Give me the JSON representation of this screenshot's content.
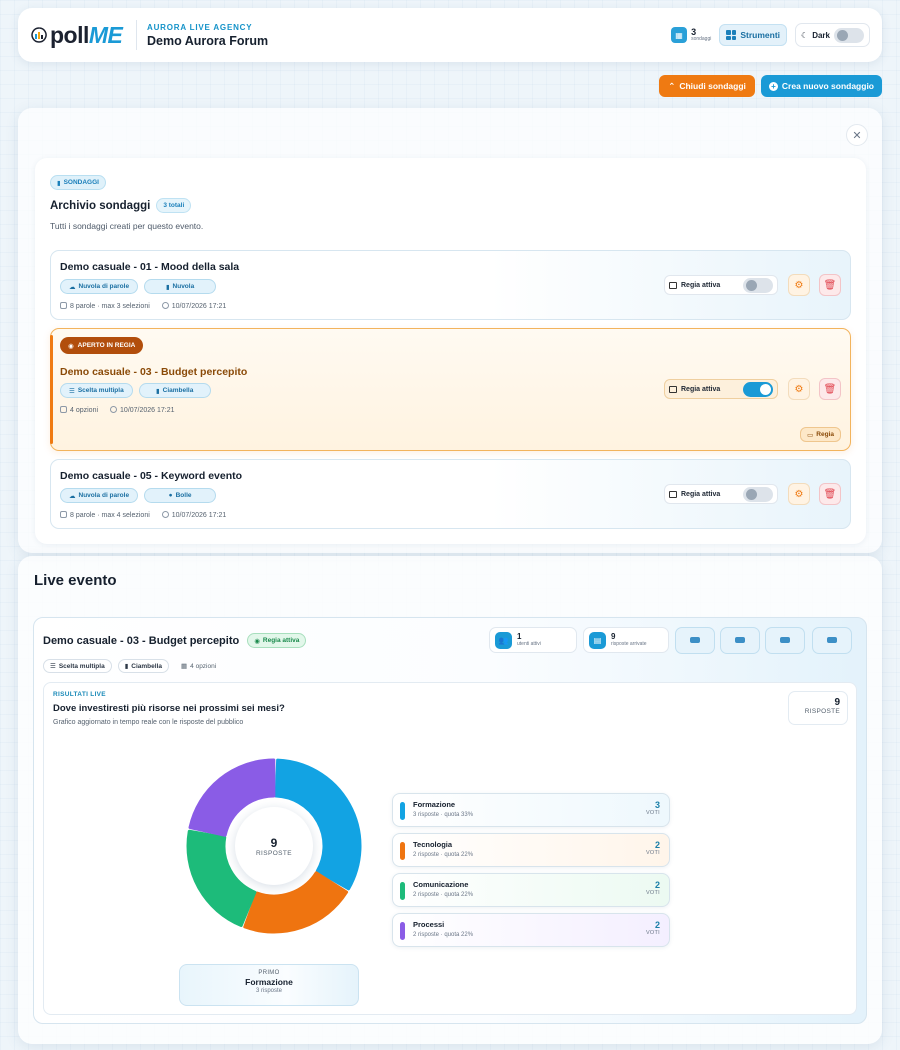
{
  "header": {
    "logo_left": "poll",
    "logo_right": "ME",
    "agency_label": "AURORA LIVE AGENCY",
    "event_title": "Demo Aurora Forum",
    "poll_count": "3",
    "poll_count_label": "sondaggi",
    "tools_label": "Strumenti",
    "dark_label": "Dark"
  },
  "actions": {
    "close_polls": "Chiudi sondaggi",
    "new_poll": "Crea nuovo sondaggio"
  },
  "archive": {
    "section_pill": "SONDAGGI",
    "title": "Archivio sondaggi",
    "total_pill": "3 totali",
    "subtitle": "Tutti i sondaggi creati per questo evento.",
    "regia_label": "Regia attiva",
    "polls": [
      {
        "title": "Demo casuale - 01 - Mood della sala",
        "tag1": "Nuvola di parole",
        "tag2": "Nuvola",
        "meta_info": "8 parole · max 3 selezioni",
        "meta_date": "10/07/2026 17:21",
        "regia_active": false
      },
      {
        "open_pill": "APERTO IN REGIA",
        "title": "Demo casuale - 03 - Budget percepito",
        "tag1": "Scelta multipla",
        "tag2": "Ciambella",
        "meta_info": "4 opzioni",
        "meta_date": "10/07/2026 17:21",
        "regia_active": true,
        "regia_small": "Regia"
      },
      {
        "title": "Demo casuale - 05 - Keyword evento",
        "tag1": "Nuvola di parole",
        "tag2": "Bolle",
        "meta_info": "8 parole · max 4 selezioni",
        "meta_date": "10/07/2026 17:21",
        "regia_active": false
      }
    ]
  },
  "live": {
    "title": "Live evento",
    "poll_title": "Demo casuale - 03 - Budget percepito",
    "regia_pill": "Regia attiva",
    "tag1": "Scelta multipla",
    "tag2": "Ciambella",
    "tag3": "4 opzioni",
    "users_num": "1",
    "users_label": "utenti attivi",
    "answers_num": "9",
    "answers_label": "risposte arrivate",
    "kicker": "RISULTATI LIVE",
    "question": "Dove investiresti più risorse nei prossimi sei mesi?",
    "question_sub": "Grafico aggiornato in tempo reale con le risposte del pubblico",
    "total_num": "9",
    "total_label": "RISPOSTE",
    "center_num": "9",
    "center_label": "RISPOSTE",
    "votes_unit": "VOTI",
    "primo_label": "PRIMO",
    "primo_name": "Formazione",
    "primo_sub": "3 risposte"
  },
  "chart_data": {
    "type": "pie",
    "categories": [
      "Formazione",
      "Tecnologia",
      "Comunicazione",
      "Processi"
    ],
    "values": [
      3,
      2,
      2,
      2
    ],
    "meta": [
      "3 risposte · quota 33%",
      "2 risposte · quota 22%",
      "2 risposte · quota 22%",
      "2 risposte · quota 22%"
    ],
    "colors": [
      "#12a3e3",
      "#ef7410",
      "#1dbb7a",
      "#8a5ce6"
    ]
  },
  "colors": {
    "accent_blue": "#1a9ad6",
    "accent_orange": "#ef7a12",
    "danger": "#e0434e"
  }
}
